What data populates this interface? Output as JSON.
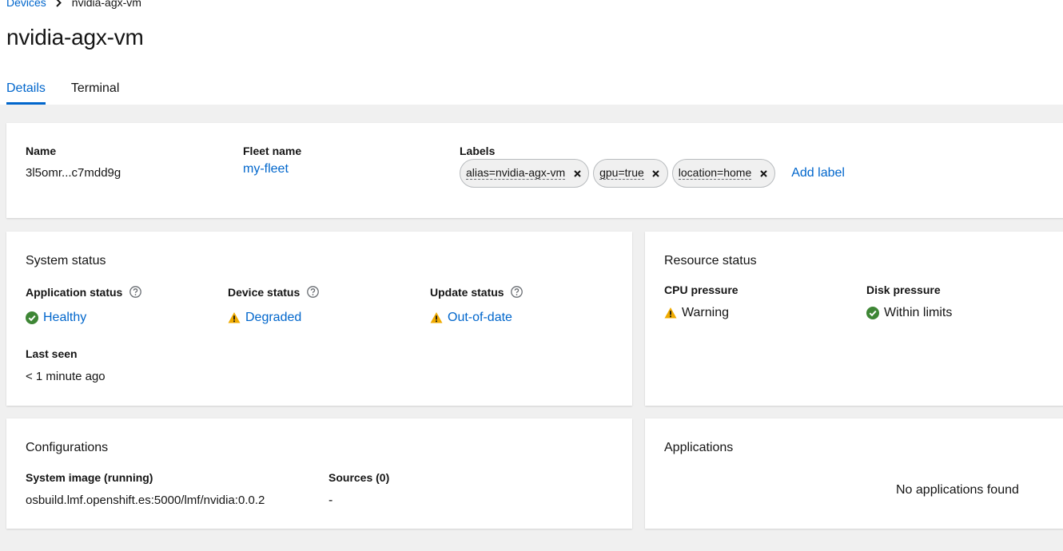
{
  "breadcrumb": {
    "parent": "Devices",
    "current": "nvidia-agx-vm"
  },
  "page": {
    "title": "nvidia-agx-vm"
  },
  "tabs": [
    {
      "label": "Details",
      "active": true
    },
    {
      "label": "Terminal",
      "active": false
    }
  ],
  "details": {
    "name_label": "Name",
    "name_value": "3l5omr...c7mdd9g",
    "fleet_label": "Fleet name",
    "fleet_value": "my-fleet",
    "labels_label": "Labels",
    "labels": [
      "alias=nvidia-agx-vm",
      "gpu=true",
      "location=home"
    ],
    "add_label": "Add label"
  },
  "system_status": {
    "title": "System status",
    "app_label": "Application status",
    "app_value": "Healthy",
    "app_icon": "check-circle-icon",
    "device_label": "Device status",
    "device_value": "Degraded",
    "device_icon": "warning-triangle-icon",
    "update_label": "Update status",
    "update_value": "Out-of-date",
    "update_icon": "warning-triangle-icon",
    "last_seen_label": "Last seen",
    "last_seen_value": "< 1 minute ago"
  },
  "resource_status": {
    "title": "Resource status",
    "cpu_label": "CPU pressure",
    "cpu_value": "Warning",
    "cpu_icon": "warning-triangle-icon",
    "disk_label": "Disk pressure",
    "disk_value": "Within limits",
    "disk_icon": "check-circle-icon"
  },
  "configurations": {
    "title": "Configurations",
    "image_label": "System image (running)",
    "image_value": "osbuild.lmf.openshift.es:5000/lmf/nvidia:0.0.2",
    "sources_label": "Sources (0)",
    "sources_value": "-"
  },
  "applications": {
    "title": "Applications",
    "empty_text": "No applications found"
  },
  "colors": {
    "link": "#0066cc",
    "success": "#3e8635",
    "warning": "#f0ab00",
    "background": "#f0f0f0"
  }
}
